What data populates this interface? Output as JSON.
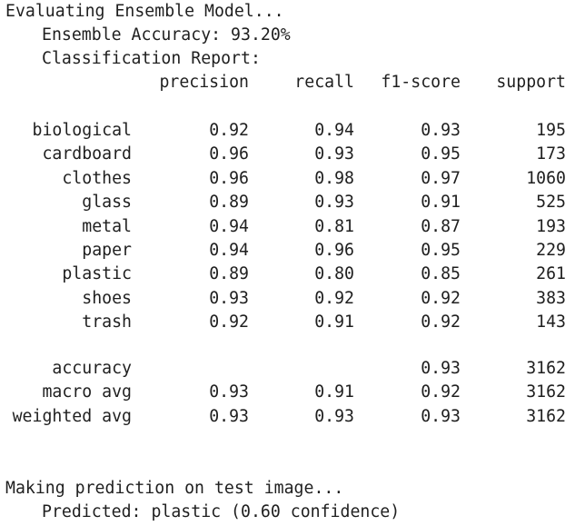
{
  "output": {
    "evaluating": "Evaluating Ensemble Model...",
    "accuracy_line": "Ensemble Accuracy: 93.20%",
    "report_title": "Classification Report:",
    "prediction_header": "Making prediction on test image...",
    "prediction_line": "Predicted: plastic (0.60 confidence)"
  },
  "report": {
    "headers": {
      "precision": "precision",
      "recall": "recall",
      "f1": "f1-score",
      "support": "support"
    },
    "rows": [
      {
        "label": "biological",
        "precision": "0.92",
        "recall": "0.94",
        "f1": "0.93",
        "support": "195"
      },
      {
        "label": "cardboard",
        "precision": "0.96",
        "recall": "0.93",
        "f1": "0.95",
        "support": "173"
      },
      {
        "label": "clothes",
        "precision": "0.96",
        "recall": "0.98",
        "f1": "0.97",
        "support": "1060"
      },
      {
        "label": "glass",
        "precision": "0.89",
        "recall": "0.93",
        "f1": "0.91",
        "support": "525"
      },
      {
        "label": "metal",
        "precision": "0.94",
        "recall": "0.81",
        "f1": "0.87",
        "support": "193"
      },
      {
        "label": "paper",
        "precision": "0.94",
        "recall": "0.96",
        "f1": "0.95",
        "support": "229"
      },
      {
        "label": "plastic",
        "precision": "0.89",
        "recall": "0.80",
        "f1": "0.85",
        "support": "261"
      },
      {
        "label": "shoes",
        "precision": "0.93",
        "recall": "0.92",
        "f1": "0.92",
        "support": "383"
      },
      {
        "label": "trash",
        "precision": "0.92",
        "recall": "0.91",
        "f1": "0.92",
        "support": "143"
      }
    ],
    "summary": [
      {
        "label": "accuracy",
        "precision": "",
        "recall": "",
        "f1": "0.93",
        "support": "3162"
      },
      {
        "label": "macro avg",
        "precision": "0.93",
        "recall": "0.91",
        "f1": "0.92",
        "support": "3162"
      },
      {
        "label": "weighted avg",
        "precision": "0.93",
        "recall": "0.93",
        "f1": "0.93",
        "support": "3162"
      }
    ]
  }
}
